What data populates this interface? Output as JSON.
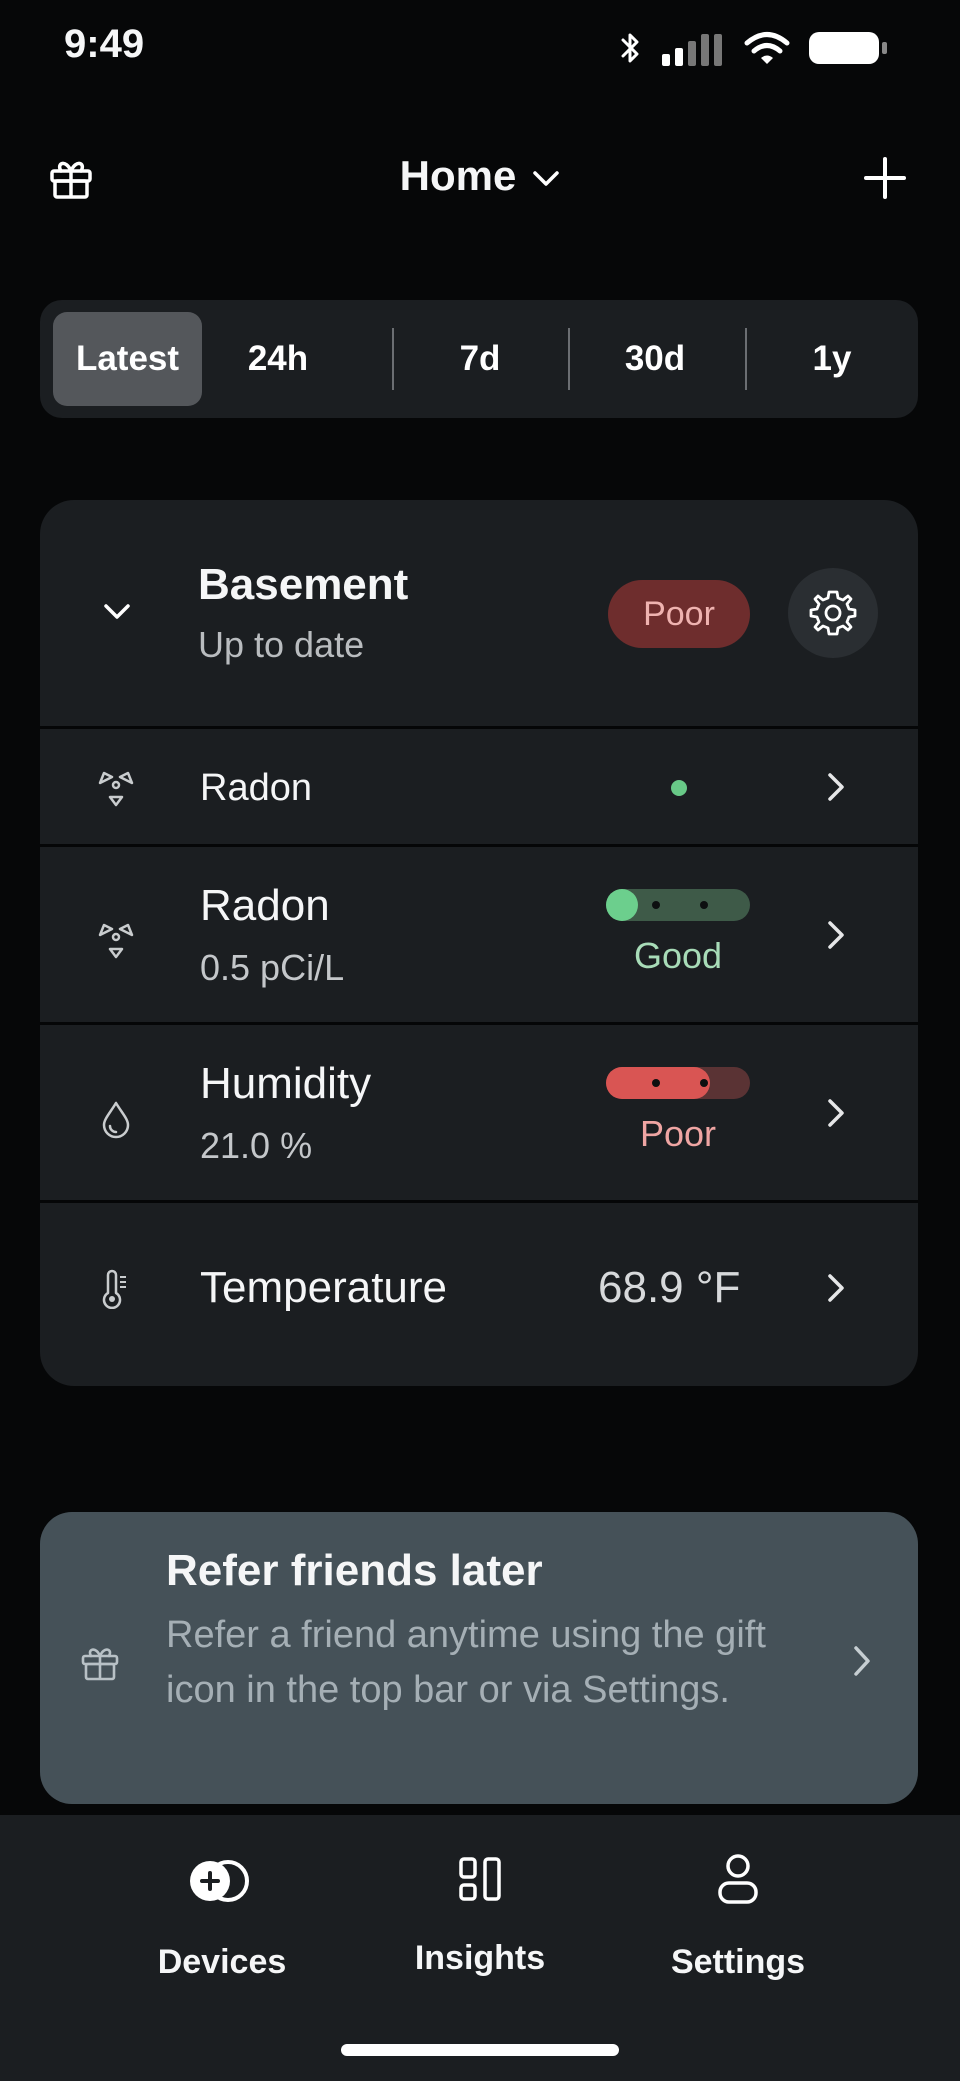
{
  "status_bar": {
    "time": "9:49"
  },
  "header": {
    "title": "Home"
  },
  "time_ranges": {
    "items": [
      "Latest",
      "24h",
      "7d",
      "30d",
      "1y"
    ],
    "selected": "Latest"
  },
  "device": {
    "name": "Basement",
    "status": "Up to date",
    "badge": "Poor",
    "colors": {
      "poor_bg": "#6e2d2d",
      "poor_text": "#efb3b0",
      "good": "#68c987",
      "poor": "#d9534f"
    },
    "sensors": [
      {
        "name": "Radon",
        "icon": "radon-icon",
        "indicator": "green-dot"
      },
      {
        "name": "Radon",
        "value": "0.5 pCi/L",
        "rating": "Good",
        "icon": "radon-icon",
        "level": 0.0
      },
      {
        "name": "Humidity",
        "value": "21.0 %",
        "rating": "Poor",
        "icon": "humidity-icon",
        "level": 0.6
      },
      {
        "name": "Temperature",
        "value": "68.9 °F",
        "icon": "thermometer-icon"
      }
    ]
  },
  "refer_banner": {
    "title": "Refer friends later",
    "body": "Refer a friend anytime using the gift icon in the top bar or via Settings."
  },
  "bottom_nav": {
    "items": [
      {
        "label": "Devices",
        "icon": "devices-icon",
        "active": true
      },
      {
        "label": "Insights",
        "icon": "insights-icon",
        "active": false
      },
      {
        "label": "Settings",
        "icon": "person-icon",
        "active": false
      }
    ]
  }
}
